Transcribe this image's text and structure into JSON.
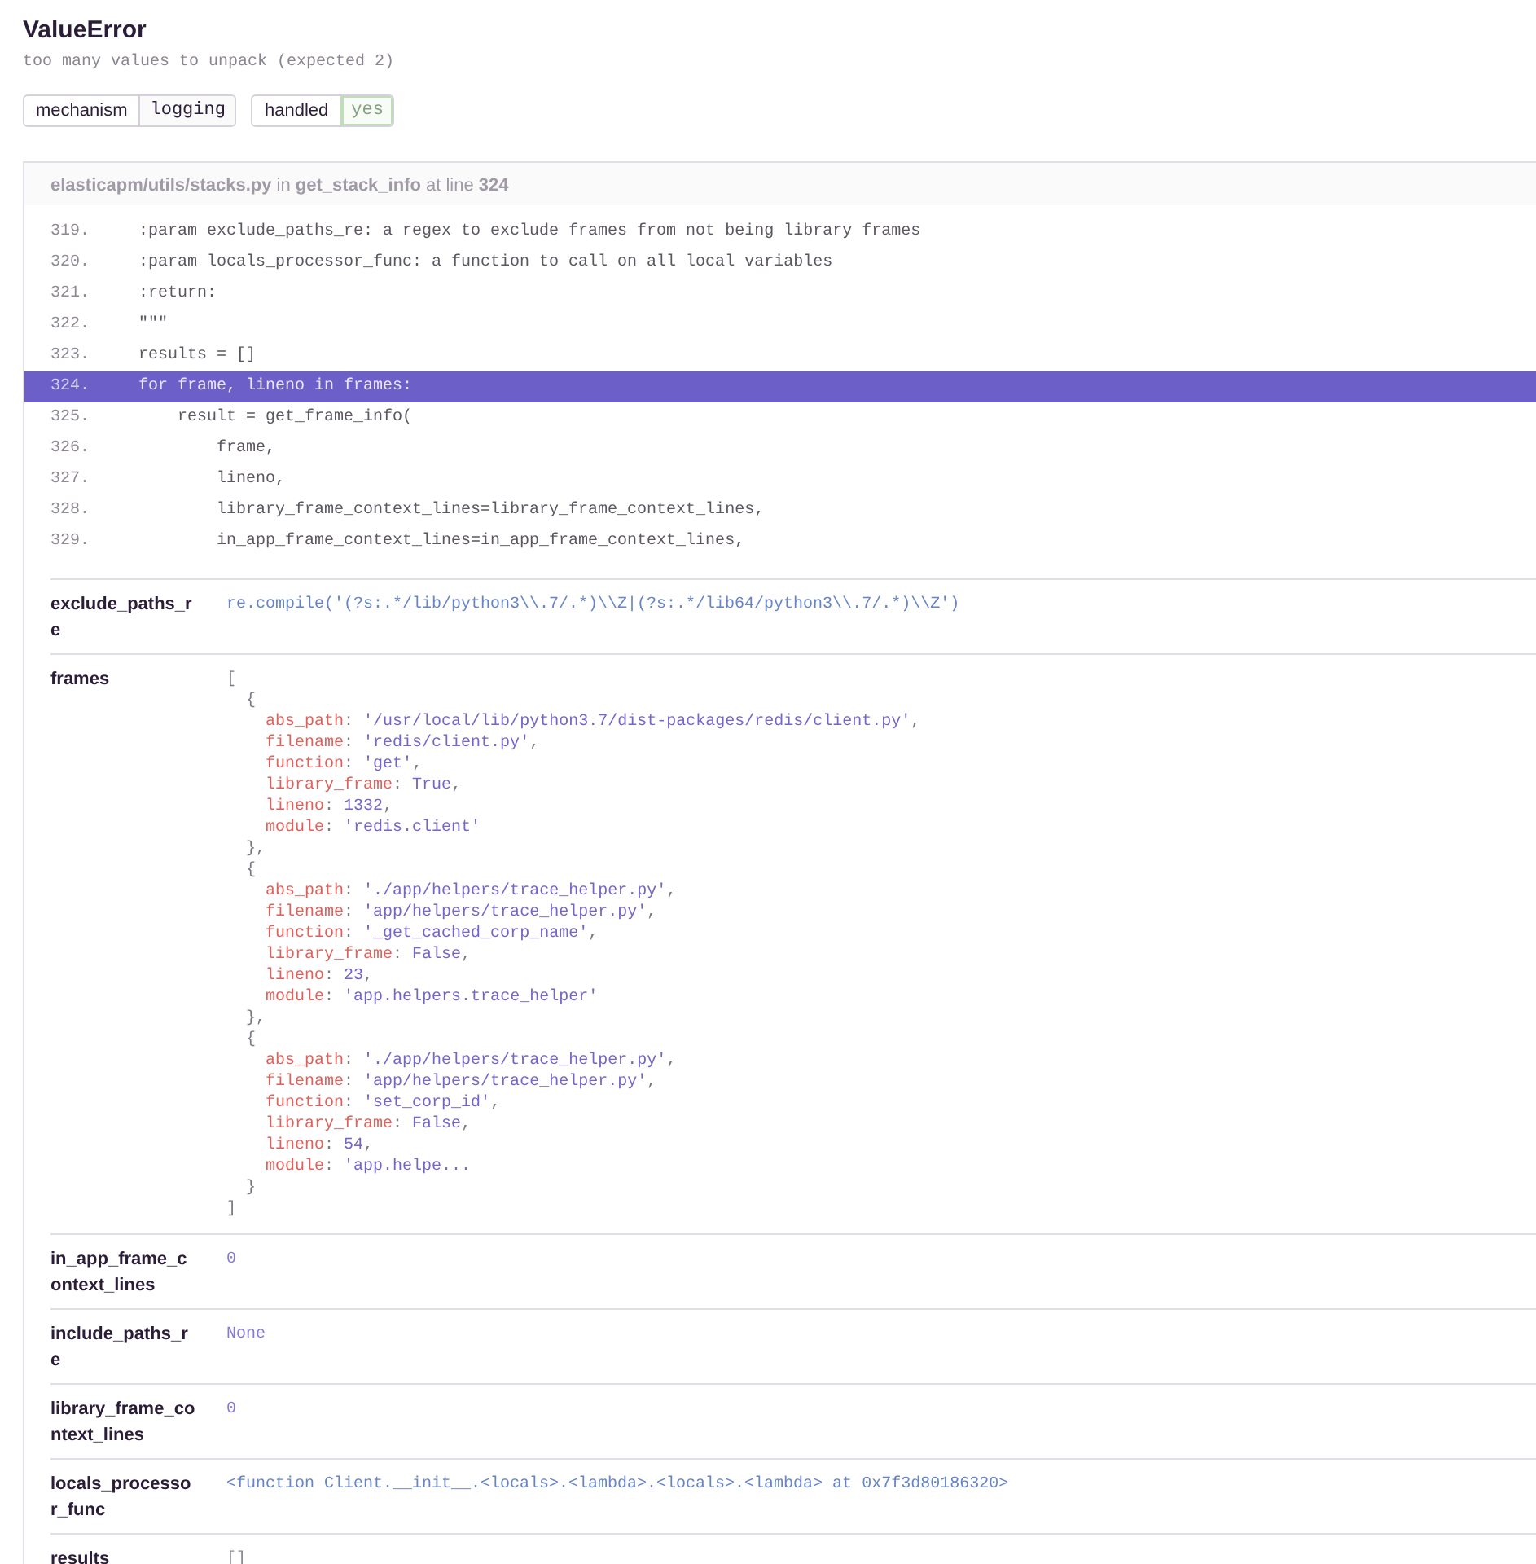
{
  "error": {
    "type": "ValueError",
    "message": "too many values to unpack (expected 2)"
  },
  "tags": [
    {
      "key": "mechanism",
      "value": "logging",
      "kind": "text"
    },
    {
      "key": "handled",
      "value": "yes",
      "kind": "positive"
    }
  ],
  "frame": {
    "title": "**elasticapm/utils/stacks.py** in **get_stack_info** at line **324**",
    "lines": [
      {
        "number": "319.",
        "code": "    :param exclude_paths_re: a regex to exclude frames from not being library frames",
        "selected": false
      },
      {
        "number": "320.",
        "code": "    :param locals_processor_func: a function to call on all local variables",
        "selected": false
      },
      {
        "number": "321.",
        "code": "    :return:",
        "selected": false
      },
      {
        "number": "322.",
        "code": "    \"\"\"",
        "selected": false
      },
      {
        "number": "323.",
        "code": "    results = []",
        "selected": false
      },
      {
        "number": "324.",
        "code": "    for frame, lineno in frames:",
        "selected": true
      },
      {
        "number": "325.",
        "code": "        result = get_frame_info(",
        "selected": false
      },
      {
        "number": "326.",
        "code": "            frame,",
        "selected": false
      },
      {
        "number": "327.",
        "code": "            lineno,",
        "selected": false
      },
      {
        "number": "328.",
        "code": "            library_frame_context_lines=library_frame_context_lines,",
        "selected": false
      },
      {
        "number": "329.",
        "code": "            in_app_frame_context_lines=in_app_frame_context_lines,",
        "selected": false
      }
    ],
    "variables": [
      {
        "name": "exclude_paths_re",
        "kind": "repr",
        "value": "re.compile('(?s:.*/lib/python3\\\\.7/.*)\\\\Z|(?s:.*/lib64/python3\\\\.7/.*)\\\\Z')"
      },
      {
        "name": "frames",
        "kind": "object_list",
        "open": "[",
        "close": "]",
        "items": [
          {
            "open": "{",
            "close": "},",
            "fields": [
              {
                "key": "abs_path",
                "sep": ":",
                "value": "'/usr/local/lib/python3.7/dist-packages/redis/client.py'",
                "end": ","
              },
              {
                "key": "filename",
                "sep": ":",
                "value": "'redis/client.py'",
                "end": ","
              },
              {
                "key": "function",
                "sep": ":",
                "value": "'get'",
                "end": ","
              },
              {
                "key": "library_frame",
                "sep": ":",
                "value": "True",
                "end": ","
              },
              {
                "key": "lineno",
                "sep": ":",
                "value": "1332",
                "end": ","
              },
              {
                "key": "module",
                "sep": ":",
                "value": "'redis.client'"
              }
            ]
          },
          {
            "open": "{",
            "close": "},",
            "fields": [
              {
                "key": "abs_path",
                "sep": ":",
                "value": "'./app/helpers/trace_helper.py'",
                "end": ","
              },
              {
                "key": "filename",
                "sep": ":",
                "value": "'app/helpers/trace_helper.py'",
                "end": ","
              },
              {
                "key": "function",
                "sep": ":",
                "value": "'_get_cached_corp_name'",
                "end": ","
              },
              {
                "key": "library_frame",
                "sep": ":",
                "value": "False",
                "end": ","
              },
              {
                "key": "lineno",
                "sep": ":",
                "value": "23",
                "end": ","
              },
              {
                "key": "module",
                "sep": ":",
                "value": "'app.helpers.trace_helper'"
              }
            ]
          },
          {
            "open": "{",
            "close": "}",
            "fields": [
              {
                "key": "abs_path",
                "sep": ":",
                "value": "'./app/helpers/trace_helper.py'",
                "end": ","
              },
              {
                "key": "filename",
                "sep": ":",
                "value": "'app/helpers/trace_helper.py'",
                "end": ","
              },
              {
                "key": "function",
                "sep": ":",
                "value": "'set_corp_id'",
                "end": ","
              },
              {
                "key": "library_frame",
                "sep": ":",
                "value": "False",
                "end": ","
              },
              {
                "key": "lineno",
                "sep": ":",
                "value": "54",
                "end": ","
              },
              {
                "key": "module",
                "sep": ":",
                "value": "'app.helpe..."
              }
            ]
          }
        ]
      },
      {
        "name": "in_app_frame_context_lines",
        "kind": "number",
        "value": "0"
      },
      {
        "name": "include_paths_re",
        "kind": "none",
        "value": "None"
      },
      {
        "name": "library_frame_context_lines",
        "kind": "number",
        "value": "0"
      },
      {
        "name": "locals_processor_func",
        "kind": "repr",
        "value": "<function Client.__init__.<locals>.<lambda>.<locals>.<lambda> at 0x7f3d80186320>"
      },
      {
        "name": "results",
        "kind": "empty",
        "value": "[]"
      }
    ]
  }
}
